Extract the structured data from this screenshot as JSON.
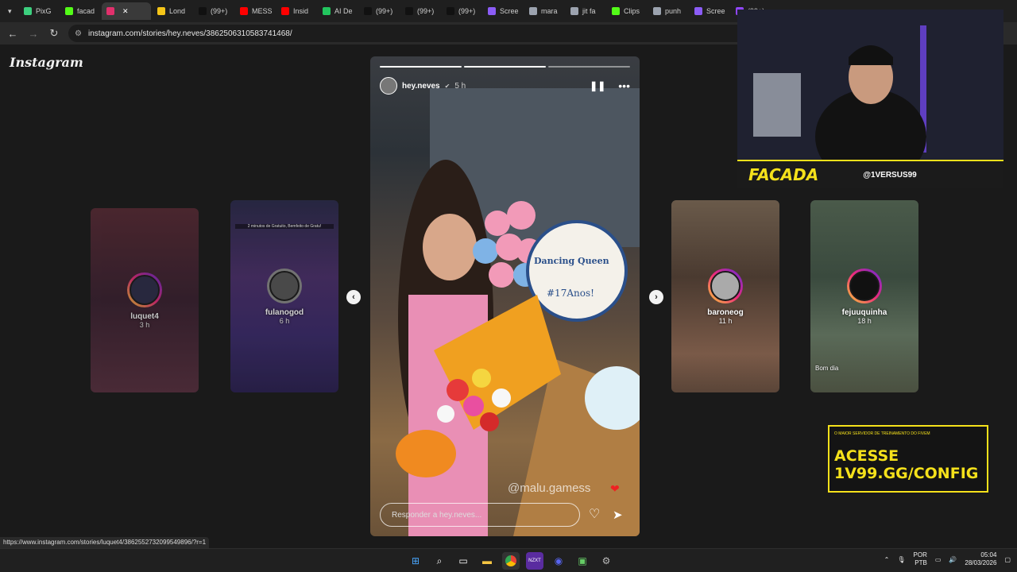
{
  "browser": {
    "tabs": [
      {
        "label": "PixG",
        "color": "#3ccf7e"
      },
      {
        "label": "facad",
        "color": "#53fc18"
      },
      {
        "label": "",
        "color": "#e1306c",
        "active": true
      },
      {
        "label": "Lond",
        "color": "#f5c518"
      },
      {
        "label": "(99+)",
        "color": "#111111"
      },
      {
        "label": "MESS",
        "color": "#ff0000"
      },
      {
        "label": "Insid",
        "color": "#ff0000"
      },
      {
        "label": "AI De",
        "color": "#22c55e"
      },
      {
        "label": "(99+)",
        "color": "#111111"
      },
      {
        "label": "(99+)",
        "color": "#111111"
      },
      {
        "label": "(99+)",
        "color": "#111111"
      },
      {
        "label": "Scree",
        "color": "#8b5cf6"
      },
      {
        "label": "mara",
        "color": "#9ca3af"
      },
      {
        "label": "jit fa",
        "color": "#9ca3af"
      },
      {
        "label": "Clips",
        "color": "#53fc18"
      },
      {
        "label": "punh",
        "color": "#9ca3af"
      },
      {
        "label": "Scree",
        "color": "#8b5cf6"
      },
      {
        "label": "(99+)",
        "color": "#9146ff"
      }
    ],
    "url": "instagram.com/stories/hey.neves/3862506310583741468/",
    "status_url": "https://www.instagram.com/stories/luquet4/3862552732099549896/?r=1"
  },
  "instagram": {
    "logo": "Instagram",
    "story": {
      "username": "hey.neves",
      "time": "5 h",
      "sticker_text": "Dancing Queen",
      "sticker_sub": "#17Anos!",
      "mention": "@malu.gamess",
      "reply_placeholder": "Responder a hey.neves...",
      "progress_segments": 3,
      "progress_done": 2
    },
    "side_stories": [
      {
        "username": "luquet4",
        "time": "3 h"
      },
      {
        "username": "fulanogod",
        "time": "6 h",
        "caption": "2 minutos de Gratuito, Bemfeito de Gratu!"
      },
      {
        "username": "baroneog",
        "time": "11 h"
      },
      {
        "username": "fejuuquinha",
        "time": "18 h",
        "caption": "Bom dia"
      }
    ],
    "colors": {
      "accent_gradient_start": "#f9ce34",
      "accent_gradient_mid": "#ee2a7b",
      "accent_gradient_end": "#6228d7"
    }
  },
  "overlay": {
    "brand": "FACADA",
    "handle": "@1VERSUS99",
    "ad_top": "O MAIOR SERVIDOR DE TREINAMENTO DO FIVEM",
    "ad_line1": "ACESSE",
    "ad_line2": "1V99.GG/CONFIG",
    "accent": "#f5e11b"
  },
  "taskbar": {
    "lang_top": "POR",
    "lang_bottom": "PTB",
    "time": "05:04",
    "date": "28/03/2026"
  }
}
